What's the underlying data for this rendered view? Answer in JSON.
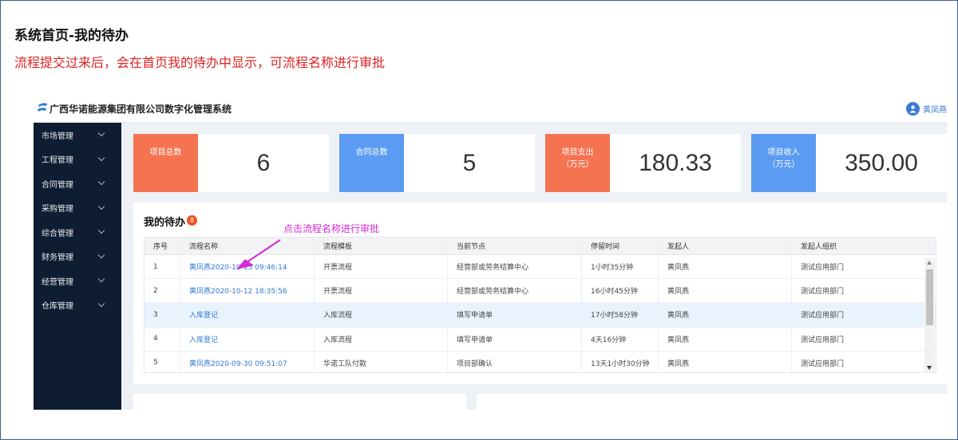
{
  "slide": {
    "title": "系统首页-我的待办",
    "subtitle": "流程提交过来后，会在首页我的待办中显示，可流程名称进行审批",
    "annotation": "点击流程名称进行审批",
    "annotation_color": "#d42ad6"
  },
  "app": {
    "brand": "广西华诺能源集团有限公司数字化管理系统",
    "user_name": "黄凤燕",
    "accent": "#3a7bd5"
  },
  "sidebar": {
    "items": [
      {
        "label": "市场管理"
      },
      {
        "label": "工程管理"
      },
      {
        "label": "合同管理"
      },
      {
        "label": "采购管理"
      },
      {
        "label": "综合管理"
      },
      {
        "label": "财务管理"
      },
      {
        "label": "经营管理"
      },
      {
        "label": "仓库管理"
      }
    ]
  },
  "stats": [
    {
      "line1": "项目总数",
      "line2": "",
      "value": "6",
      "color": "#f47452"
    },
    {
      "line1": "合同总数",
      "line2": "",
      "value": "5",
      "color": "#5b9cf2"
    },
    {
      "line1": "项目支出",
      "line2": "（万元）",
      "value": "180.33",
      "color": "#f47452"
    },
    {
      "line1": "项目收入",
      "line2": "（万元）",
      "value": "350.00",
      "color": "#5b9cf2"
    }
  ],
  "todo": {
    "title": "我的待办",
    "count": "8",
    "columns": [
      "序号",
      "流程名称",
      "流程模板",
      "当前节点",
      "停留时间",
      "发起人",
      "发起人组织"
    ],
    "rows": [
      {
        "no": "1",
        "name": "黄凤燕2020-10-13 09:46:14",
        "template": "开票流程",
        "node": "经营部或劳务结算中心",
        "stay": "1小时35分钟",
        "initiator": "黄凤燕",
        "org": "测试应用部门"
      },
      {
        "no": "2",
        "name": "黄凤燕2020-10-12 18:35:56",
        "template": "开票流程",
        "node": "经营部或劳务结算中心",
        "stay": "16小时45分钟",
        "initiator": "黄凤燕",
        "org": "测试应用部门"
      },
      {
        "no": "3",
        "name": "入库登记",
        "template": "入库流程",
        "node": "填写申请单",
        "stay": "17小时58分钟",
        "initiator": "黄凤燕",
        "org": "测试应用部门"
      },
      {
        "no": "4",
        "name": "入库登记",
        "template": "入库流程",
        "node": "填写申请单",
        "stay": "4天16分钟",
        "initiator": "黄凤燕",
        "org": "测试应用部门"
      },
      {
        "no": "5",
        "name": "黄凤燕2020-09-30 09:51:07",
        "template": "华诺工队付款",
        "node": "项目部确认",
        "stay": "13天1小时30分钟",
        "initiator": "黄凤燕",
        "org": "测试应用部门"
      }
    ]
  }
}
